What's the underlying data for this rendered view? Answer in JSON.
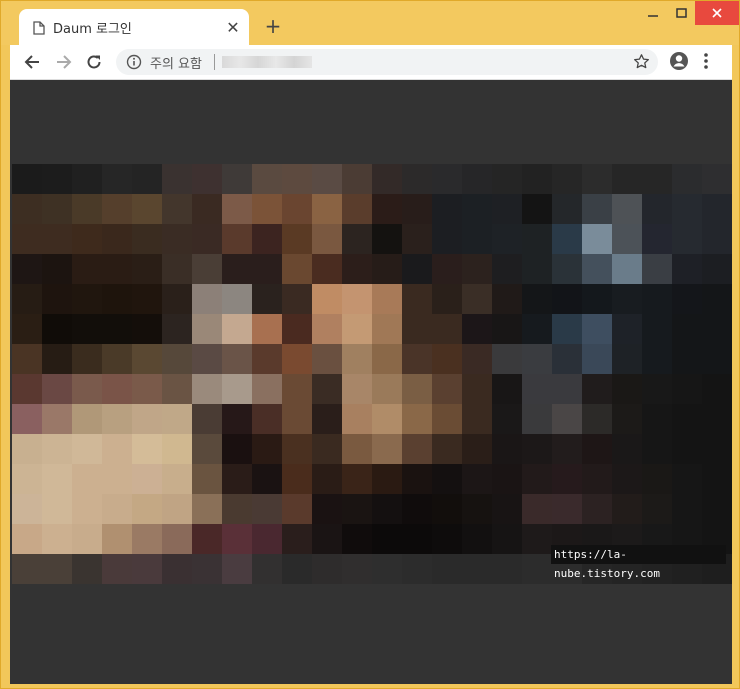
{
  "tab": {
    "title": "Daum 로그인",
    "close_glyph": "✕"
  },
  "toolbar": {
    "new_tab_glyph": "+",
    "security_label": "주의 요함"
  },
  "page": {
    "watermark": "https://la-nube.tistory.com"
  },
  "colors": {
    "frame": "#f3c95f",
    "close_button": "#e8493e",
    "content_bg": "#333333"
  }
}
